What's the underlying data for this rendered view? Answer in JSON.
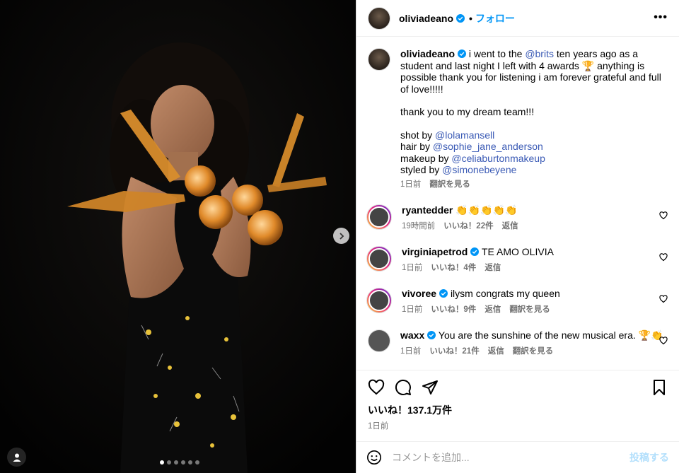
{
  "post": {
    "username": "oliviadeano",
    "follow_label": "フォロー",
    "dot": "•",
    "more_icon": "more-horizontal-icon"
  },
  "caption": {
    "username": "oliviadeano",
    "line1_pre": "i went to the ",
    "mention_brits": "@brits",
    "line1_post": " ten years ago as a student and last night I left with 4 awards 🏆 anything is possible thank you for listening i am forever grateful and full of love!!!!!",
    "thanks": "thank you to my dream team!!!",
    "shot_label": "shot by ",
    "shot_by": "@lolamansell",
    "hair_label": "hair by ",
    "hair_by": "@sophie_jane_anderson",
    "makeup_label": "makeup by ",
    "makeup_by": "@celiaburtonmakeup",
    "styled_label": "styled by ",
    "styled_by": "@simonebeyene",
    "time": "1日前",
    "translate": "翻訳を見る"
  },
  "comments": [
    {
      "username": "ryantedder",
      "verified": false,
      "text": "👏👏👏👏👏",
      "time": "19時間前",
      "likes": "いいね！22件",
      "reply": "返信",
      "translate": ""
    },
    {
      "username": "virginiapetrod",
      "verified": true,
      "text": "TE AMO OLIVIA",
      "time": "1日前",
      "likes": "いいね！4件",
      "reply": "返信",
      "translate": ""
    },
    {
      "username": "vivoree",
      "verified": true,
      "text": "ilysm congrats my queen",
      "time": "1日前",
      "likes": "いいね！9件",
      "reply": "返信",
      "translate": "翻訳を見る"
    },
    {
      "username": "waxx",
      "verified": true,
      "text": "You are the sunshine of the new musical era. 🏆👏",
      "time": "1日前",
      "likes": "いいね！21件",
      "reply": "返信",
      "translate": "翻訳を見る"
    }
  ],
  "actions": {
    "likes": "いいね！137.1万件",
    "time": "1日前"
  },
  "add_comment": {
    "placeholder": "コメントを追加...",
    "post_label": "投稿する"
  },
  "carousel": {
    "total": 6,
    "active": 1
  },
  "colors": {
    "accent": "#0095f6",
    "link": "#3a5ab5",
    "muted": "#737373"
  }
}
